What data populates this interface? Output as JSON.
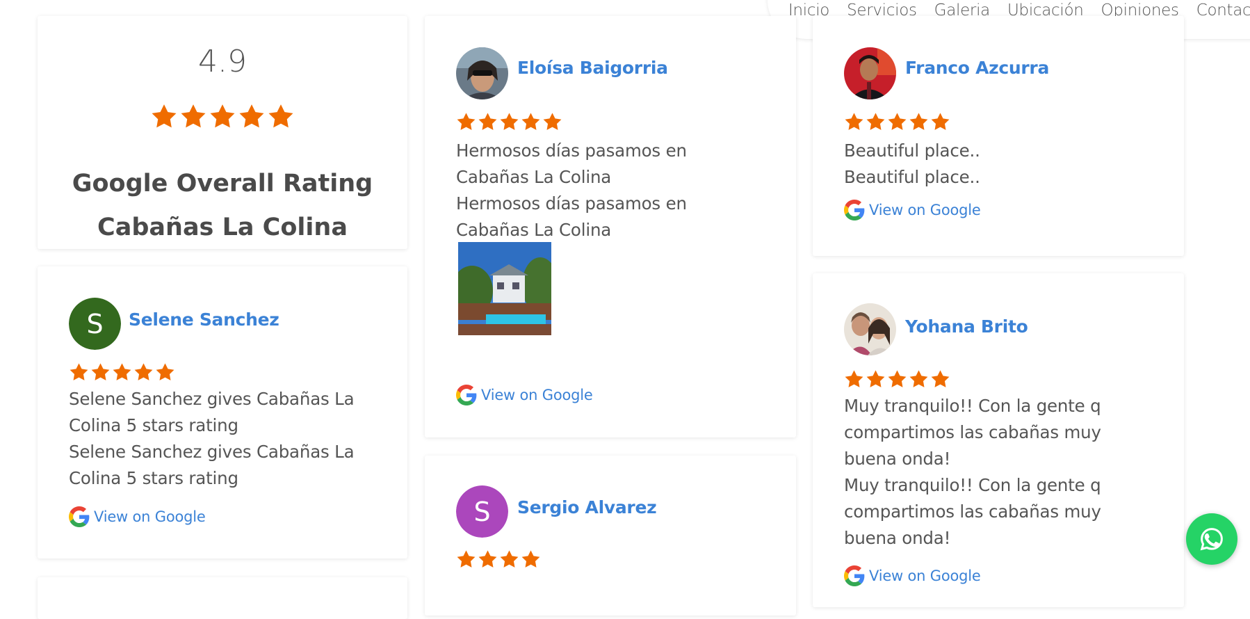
{
  "nav": {
    "items": [
      "Inicio",
      "Servicios",
      "Galeria",
      "Ubicación",
      "Opiniones",
      "Contacto"
    ]
  },
  "overall": {
    "score": "4.9",
    "stars": 5,
    "title_line1": "Google Overall Rating",
    "title_line2": "Cabañas La Colina"
  },
  "colors": {
    "star": "#ef6c00",
    "link": "#3b82d6",
    "whatsapp": "#25d366"
  },
  "view_label": "View on Google",
  "reviews": {
    "eloisa": {
      "name": "Eloísa Baigorria",
      "stars": 5,
      "text": [
        "Hermosos días pasamos en",
        "Cabañas La Colina",
        "Hermosos días pasamos en",
        "Cabañas La Colina"
      ]
    },
    "franco": {
      "name": "Franco Azcurra",
      "stars": 5,
      "text": [
        "Beautiful place..",
        "Beautiful place.."
      ]
    },
    "selene": {
      "name": "Selene Sanchez",
      "avatar_letter": "S",
      "avatar_color": "#33691e",
      "stars": 5,
      "text": [
        "Selene Sanchez gives Cabañas La",
        "Colina 5 stars rating",
        "Selene Sanchez gives Cabañas La",
        "Colina 5 stars rating"
      ]
    },
    "yohana": {
      "name": "Yohana Brito",
      "stars": 5,
      "text": [
        "Muy tranquilo!! Con la gente q",
        "compartimos las cabañas muy",
        "buena onda!",
        "Muy tranquilo!! Con la gente q",
        "compartimos las cabañas muy",
        "buena onda!"
      ]
    },
    "sergio": {
      "name": "Sergio Alvarez",
      "avatar_letter": "S",
      "avatar_color": "#ab47bc",
      "stars": 4
    }
  },
  "icons": {
    "star": "star-icon",
    "google": "google-g-icon",
    "whatsapp": "whatsapp-icon"
  }
}
